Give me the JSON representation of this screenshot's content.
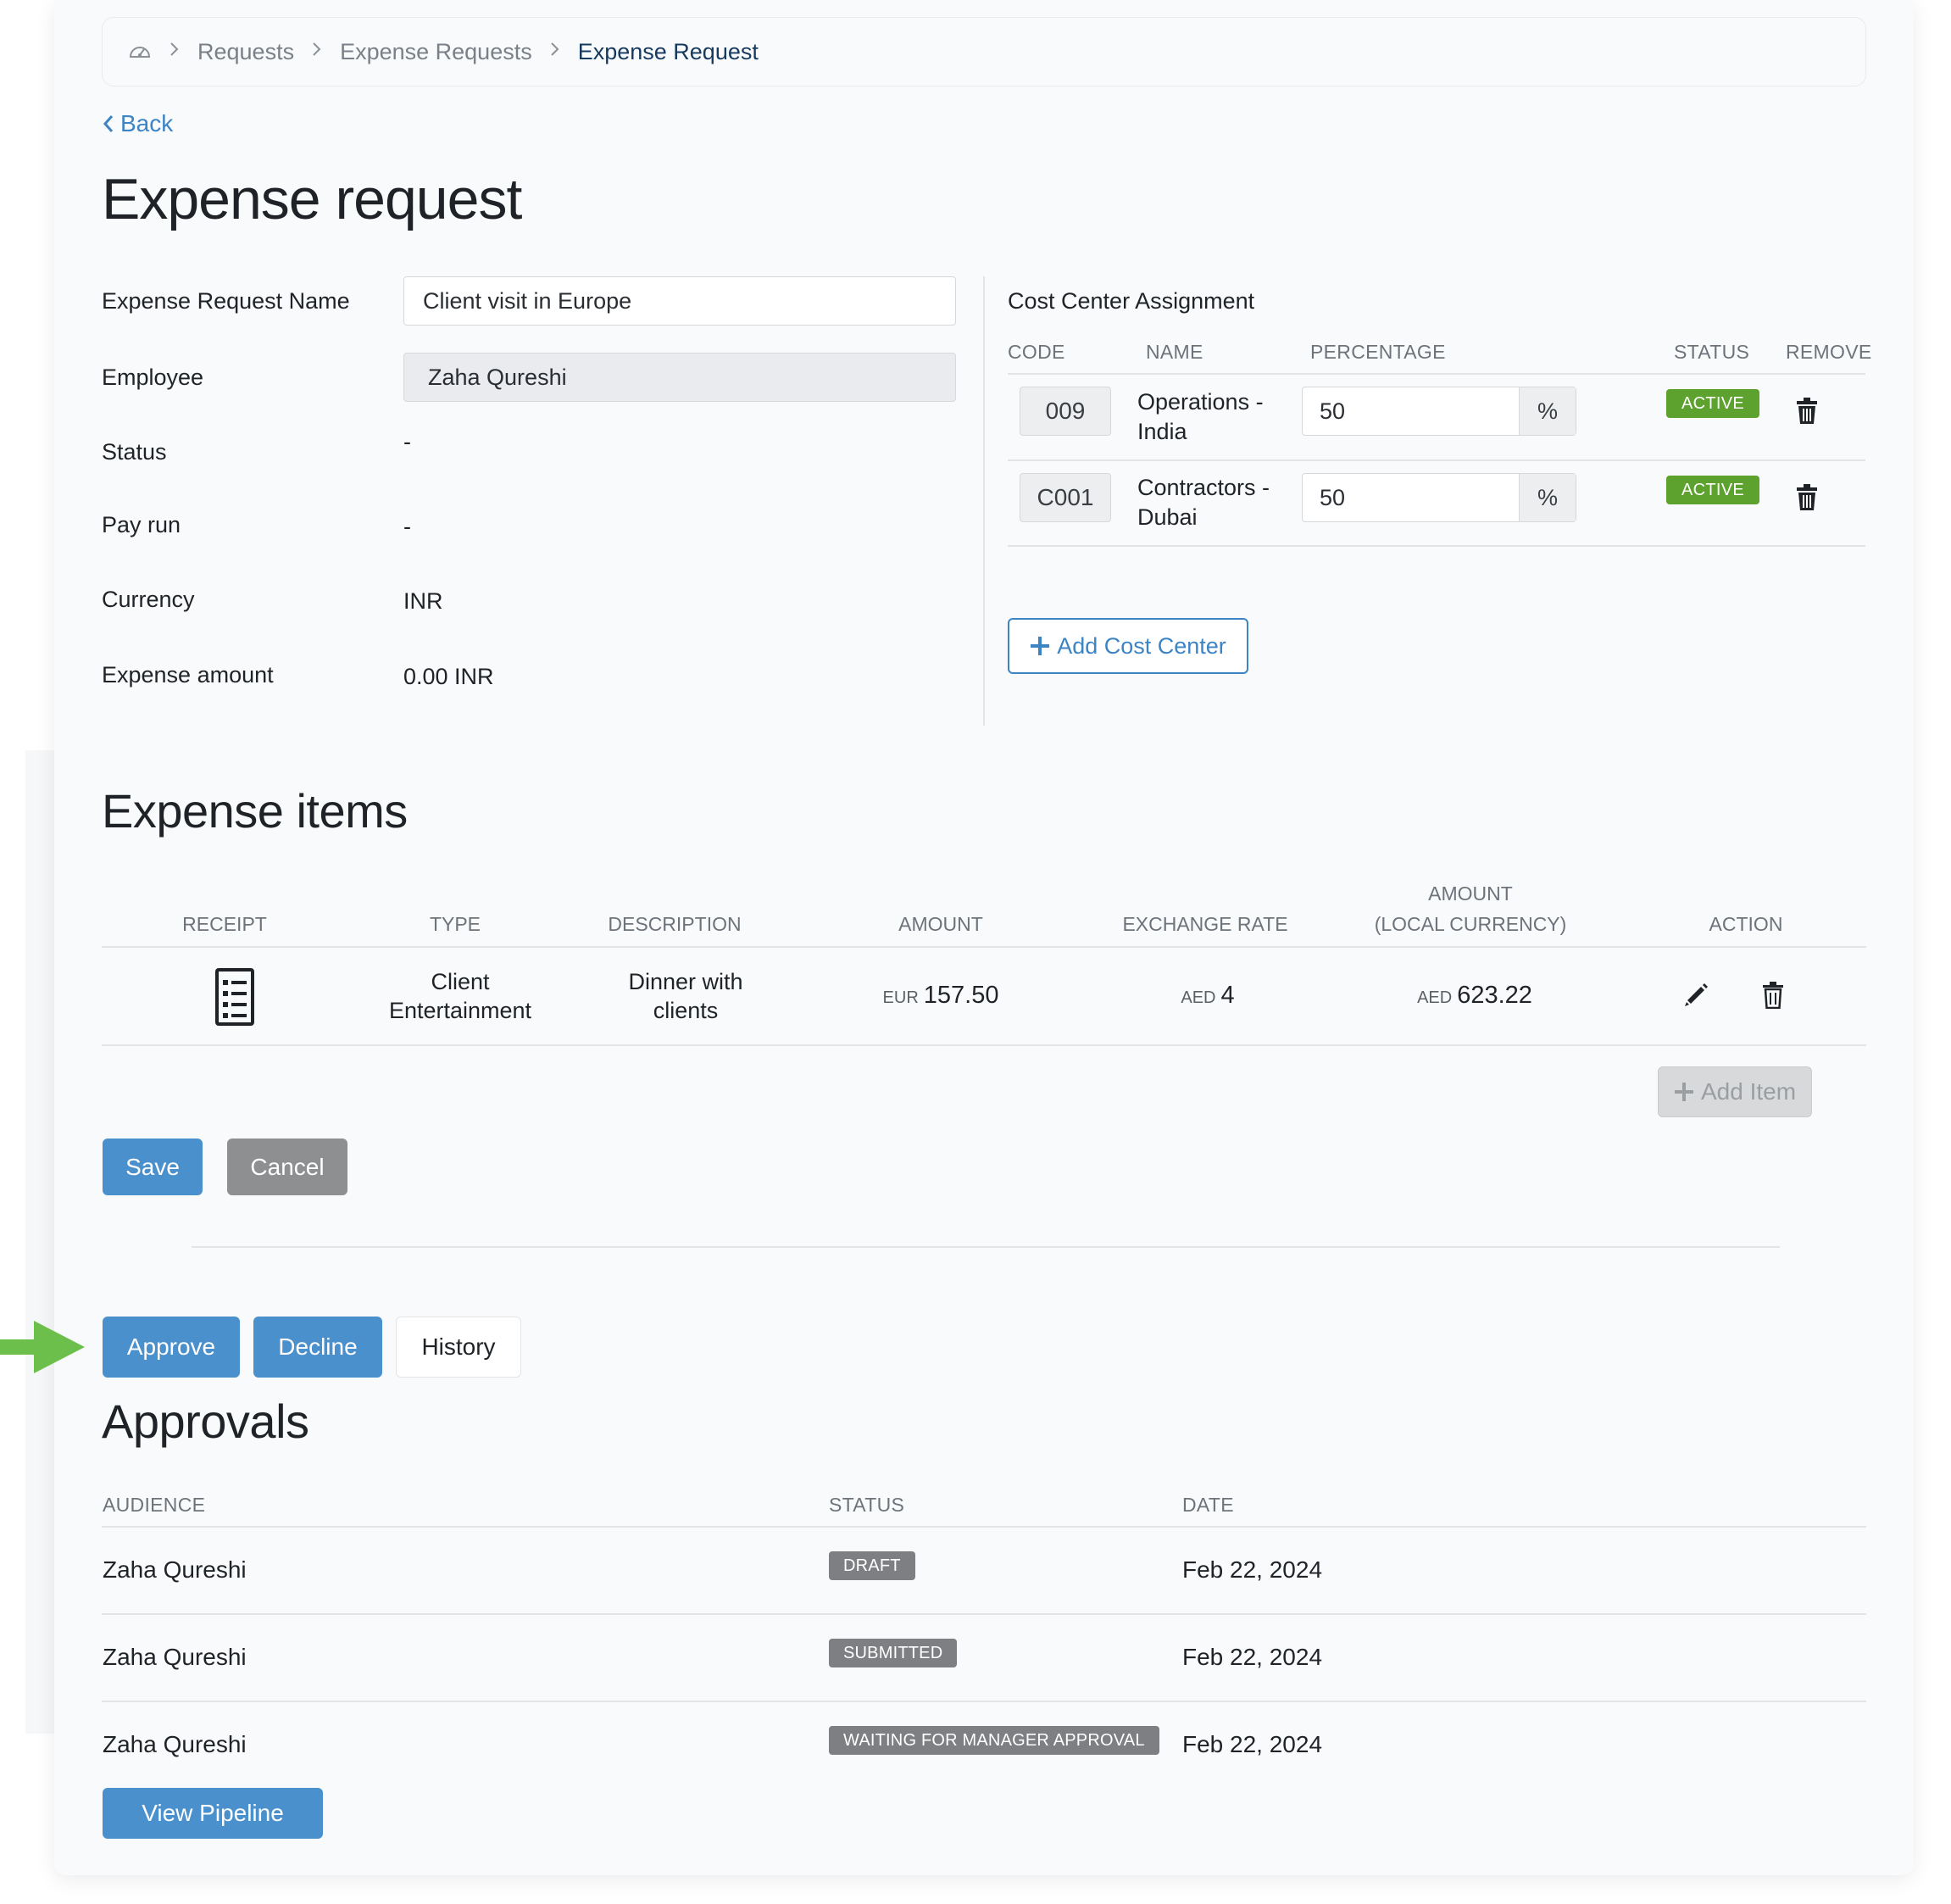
{
  "breadcrumb": {
    "items": [
      "Requests",
      "Expense Requests"
    ],
    "current": "Expense Request",
    "sep": ">"
  },
  "back_label": "Back",
  "page_title": "Expense request",
  "form": {
    "name_label": "Expense Request Name",
    "name_value": "Client visit in Europe",
    "employee_label": "Employee",
    "employee_value": "Zaha Qureshi",
    "status_label": "Status",
    "status_value": "-",
    "payrun_label": "Pay run",
    "payrun_value": "-",
    "currency_label": "Currency",
    "currency_value": "INR",
    "amount_label": "Expense amount",
    "amount_value": "0.00 INR"
  },
  "cost_center": {
    "title": "Cost Center Assignment",
    "headers": {
      "code": "CODE",
      "name": "NAME",
      "percentage": "PERCENTAGE",
      "status": "STATUS",
      "remove": "REMOVE"
    },
    "rows": [
      {
        "code": "009",
        "name_line1": "Operations -",
        "name_line2": "India",
        "percentage": "50",
        "unit": "%",
        "status": "ACTIVE"
      },
      {
        "code": "C001",
        "name_line1": "Contractors -",
        "name_line2": "Dubai",
        "percentage": "50",
        "unit": "%",
        "status": "ACTIVE"
      }
    ],
    "add_label": "Add Cost Center",
    "status_color": "#5da22e"
  },
  "expense_items": {
    "title": "Expense items",
    "headers": {
      "receipt": "RECEIPT",
      "type": "TYPE",
      "description": "DESCRIPTION",
      "amount": "AMOUNT",
      "exchange_rate": "EXCHANGE RATE",
      "local_line1": "AMOUNT",
      "local_line2": "(LOCAL CURRENCY)",
      "action": "ACTION"
    },
    "rows": [
      {
        "type_line1": "Client",
        "type_line2": "Entertainment",
        "desc_line1": "Dinner with",
        "desc_line2": "clients",
        "amount_currency": "EUR",
        "amount": "157.50",
        "rate_currency": "AED",
        "rate": "4",
        "local_currency": "AED",
        "local_amount": "623.22"
      }
    ],
    "add_item_label": "Add Item"
  },
  "actions": {
    "save": "Save",
    "cancel": "Cancel",
    "approve": "Approve",
    "decline": "Decline",
    "history": "History",
    "view_pipeline": "View Pipeline"
  },
  "approvals": {
    "title": "Approvals",
    "headers": {
      "audience": "AUDIENCE",
      "status": "STATUS",
      "date": "DATE"
    },
    "rows": [
      {
        "audience": "Zaha Qureshi",
        "status": "DRAFT",
        "date": "Feb 22, 2024"
      },
      {
        "audience": "Zaha Qureshi",
        "status": "SUBMITTED",
        "date": "Feb 22, 2024"
      },
      {
        "audience": "Zaha Qureshi",
        "status": "WAITING FOR MANAGER APPROVAL",
        "date": "Feb 22, 2024"
      }
    ]
  },
  "colors": {
    "primary": "#4a90cc",
    "link": "#3c84c4",
    "arrow": "#6cbf4a"
  },
  "icons": [
    "dashboard-icon",
    "chevron-right-icon",
    "chevron-left-icon",
    "trash-icon",
    "plus-icon",
    "receipt-icon",
    "pencil-icon",
    "arrow-right-icon"
  ]
}
